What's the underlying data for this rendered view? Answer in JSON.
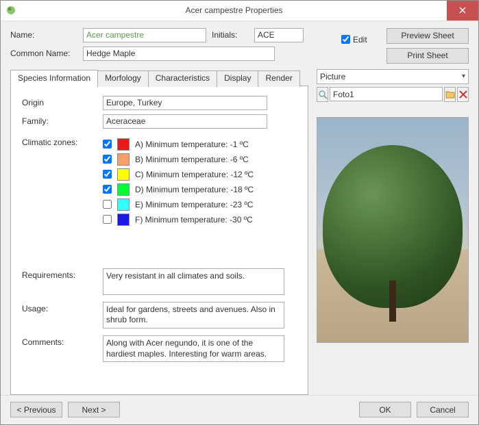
{
  "titlebar": {
    "title": "Acer campestre Properties"
  },
  "top": {
    "name_label": "Name:",
    "name_value": "Acer campestre",
    "initials_label": "Initials:",
    "initials_value": "ACE",
    "common_label": "Common Name:",
    "common_value": "Hedge Maple",
    "edit_label": "Edit",
    "preview_btn": "Preview Sheet",
    "print_btn": "Print Sheet"
  },
  "tabs": [
    "Species Information",
    "Morfology",
    "Characteristics",
    "Display",
    "Render"
  ],
  "species": {
    "origin_label": "Origin",
    "origin_value": "Europe, Turkey",
    "family_label": "Family:",
    "family_value": "Aceraceae",
    "zones_label": "Climatic zones:",
    "zones": [
      {
        "checked": true,
        "color": "#e81b1b",
        "label": "A) Minimum temperature: -1 ºC"
      },
      {
        "checked": true,
        "color": "#f5a06b",
        "label": "B) Minimum temperature: -6 ºC"
      },
      {
        "checked": true,
        "color": "#ffff00",
        "label": "C) Minimum temperature: -12 ºC"
      },
      {
        "checked": true,
        "color": "#00ff33",
        "label": "D) Minimum temperature: -18 ºC"
      },
      {
        "checked": false,
        "color": "#33ffff",
        "label": "E) Minimum temperature: -23 ºC"
      },
      {
        "checked": false,
        "color": "#1a1ae6",
        "label": "F) Minimum temperature: -30 ºC"
      }
    ],
    "req_label": "Requirements:",
    "req_value": "Very resistant in all climates and soils.",
    "usage_label": "Usage:",
    "usage_value": "Ideal for gardens, streets and avenues. Also in shrub form.",
    "comments_label": "Comments:",
    "comments_value": "Along with Acer negundo, it is one of the hardiest maples. Interesting for warm areas."
  },
  "picture": {
    "section_label": "Picture",
    "name_value": "Foto1"
  },
  "footer": {
    "prev": "< Previous",
    "next": "Next >",
    "ok": "OK",
    "cancel": "Cancel"
  }
}
